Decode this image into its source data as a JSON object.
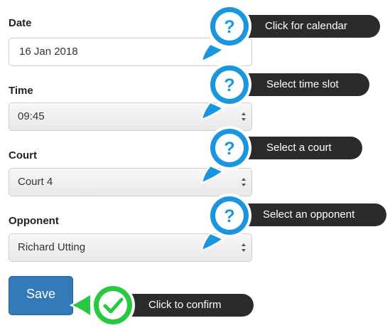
{
  "form": {
    "date": {
      "label": "Date",
      "value": "16 Jan 2018"
    },
    "time": {
      "label": "Time",
      "value": "09:45"
    },
    "court": {
      "label": "Court",
      "value": "Court 4"
    },
    "opponent": {
      "label": "Opponent",
      "value": "Richard Utting"
    },
    "save_label": "Save"
  },
  "tooltips": {
    "calendar": "Click for calendar",
    "time_slot": "Select time slot",
    "court": "Select a court",
    "opponent": "Select an opponent",
    "confirm": "Click to confirm"
  },
  "colors": {
    "help_blue": "#1a96e0",
    "confirm_green": "#27c93f",
    "tooltip_bg": "#2b2b2b",
    "button_blue": "#357ab8"
  },
  "icons": {
    "help": "question-mark-icon",
    "confirm": "check-icon"
  }
}
